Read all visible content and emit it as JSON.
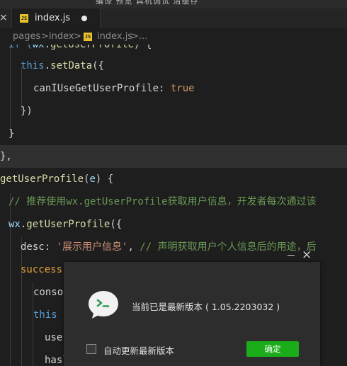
{
  "menu": {
    "labels": "编译  预览  真机调试  清缓存"
  },
  "tabs": [
    {
      "label": "index.js",
      "badge": "JS",
      "close": "×"
    }
  ],
  "breadcrumb": {
    "parts": [
      "pages",
      "index",
      "index.js",
      "..."
    ],
    "sep": ">",
    "badge": "JS"
  },
  "code": {
    "l0_a": "if (",
    "l0_b": "wx",
    "l0_c": ".",
    "l0_d": "getUserProfile",
    "l0_e": ") {",
    "l1_kw": "this",
    "l1_dot": ".",
    "l1_fn": "setData",
    "l1_p": "({",
    "l2_prop": "canIUseGetUserProfile",
    "l2_colon": ": ",
    "l2_val": "true",
    "l3": "})",
    "l4": "}",
    "l5": "},",
    "l6_fn": "getUserProfile",
    "l6_p1": "(",
    "l6_arg": "e",
    "l6_p2": ") {",
    "l7_cm": "// 推荐使用wx.getUserProfile获取用户信息，开发者每次通过该",
    "l8_obj": "wx",
    "l8_dot": ".",
    "l8_fn": "getUserProfile",
    "l8_p": "({",
    "l9_prop": "desc",
    "l9_colon": ": ",
    "l9_str": "'展示用户信息'",
    "l9_comma": ",",
    "l9_cm": " // 声明获取用户个人信息后的用途，后",
    "l10_prop": "success",
    "l11": "conso",
    "l12_kw": "this",
    "l13": "user",
    "l14": "hasl"
  },
  "dialog": {
    "message": "当前已是最新版本 ( 1.05.2203032 )",
    "checkbox_label": "自动更新最新版本",
    "confirm_label": "确定",
    "close": "×"
  }
}
